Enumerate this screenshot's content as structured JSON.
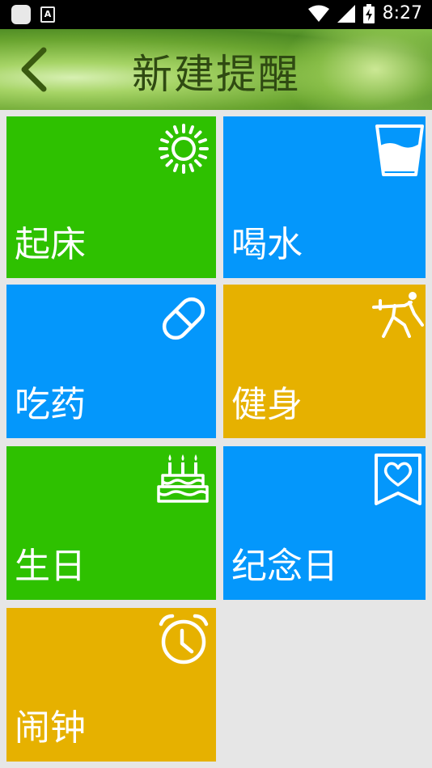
{
  "status_bar": {
    "time": "8:27",
    "icons": [
      "app-icon",
      "font-icon",
      "wifi-icon",
      "signal-icon",
      "battery-charging-icon"
    ]
  },
  "header": {
    "title": "新建提醒",
    "back_icon": "chevron-left-icon"
  },
  "colors": {
    "green": "#2ec100",
    "blue": "#0497fb",
    "yellow": "#e6b100",
    "background": "#e6e6e6"
  },
  "tiles": [
    {
      "label": "起床",
      "icon": "sun-icon",
      "color": "#2ec100"
    },
    {
      "label": "喝水",
      "icon": "water-glass-icon",
      "color": "#0497fb"
    },
    {
      "label": "吃药",
      "icon": "pill-icon",
      "color": "#0497fb"
    },
    {
      "label": "健身",
      "icon": "fitness-icon",
      "color": "#e6b100"
    },
    {
      "label": "生日",
      "icon": "birthday-cake-icon",
      "color": "#2ec100"
    },
    {
      "label": "纪念日",
      "icon": "heart-bookmark-icon",
      "color": "#0497fb"
    },
    {
      "label": "闹钟",
      "icon": "alarm-clock-icon",
      "color": "#e6b100"
    }
  ]
}
